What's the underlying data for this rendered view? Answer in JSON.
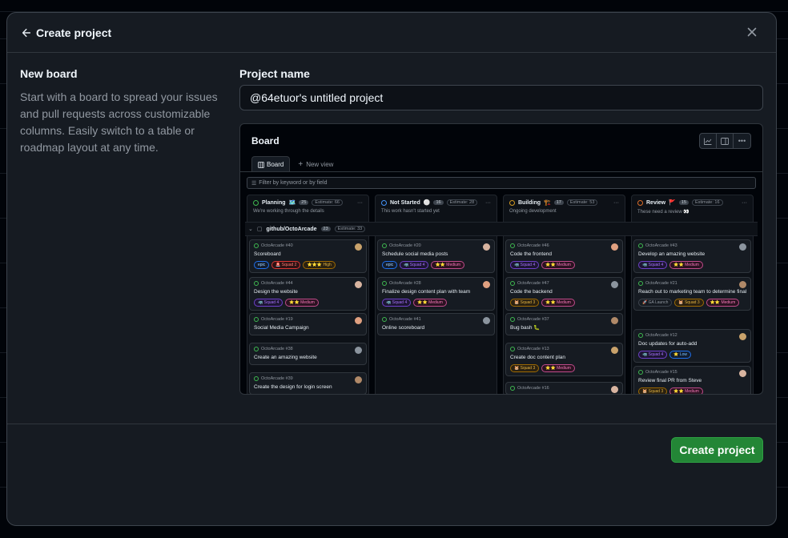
{
  "dialog": {
    "title": "Create project",
    "sidebar": {
      "title": "New board",
      "description": "Start with a board to spread your issues and pull requests across customizable columns. Easily switch to a table or roadmap layout at any time."
    },
    "field": {
      "label": "Project name",
      "value": "@64etuor's untitled project"
    },
    "submit_label": "Create project"
  },
  "preview": {
    "title": "Board",
    "tabs": {
      "active": "Board",
      "new": "New view"
    },
    "filter_placeholder": "Filter by keyword or by field",
    "group": {
      "name": "github/OctoArcade",
      "count": "23",
      "estimate": "Estimate: 33"
    },
    "columns": [
      {
        "name": "Planning",
        "emoji": "🗺️",
        "count": "25",
        "estimate": "Estimate: 66",
        "description": "We're working through the details",
        "status_color": "#3fb950",
        "cards": [
          {
            "ref": "OctoArcade #40",
            "title": "Scoreboard",
            "tags": [
              "epic",
              "🚨 Squad 2",
              "⭐⭐⭐ High"
            ]
          },
          {
            "ref": "OctoArcade #44",
            "title": "Design the website",
            "tags": [
              "🦏 Squad 4",
              "⭐⭐ Medium"
            ]
          },
          {
            "ref": "OctoArcade #19",
            "title": "Social Media Campaign",
            "tags": []
          },
          {
            "ref": "OctoArcade #38",
            "title": "Create an amazing website",
            "tags": []
          },
          {
            "ref": "OctoArcade #39",
            "title": "Create the design for login screen",
            "tags": []
          }
        ]
      },
      {
        "name": "Not Started",
        "emoji": "⚪",
        "count": "16",
        "estimate": "Estimate: 28",
        "description": "This work hasn't started yet",
        "status_color": "#4493f8",
        "cards": [
          {
            "ref": "OctoArcade #20",
            "title": "Schedule social media posts",
            "tags": [
              "epic",
              "🦏 Squad 4",
              "⭐⭐ Medium"
            ]
          },
          {
            "ref": "OctoArcade #28",
            "title": "Finalize design content plan with team",
            "tags": [
              "🦏 Squad 4",
              "⭐⭐ Medium"
            ]
          },
          {
            "ref": "OctoArcade #41",
            "title": "Online scoreboard",
            "tags": []
          }
        ]
      },
      {
        "name": "Building",
        "emoji": "🏗️",
        "count": "17",
        "estimate": "Estimate: 53",
        "description": "Ongoing development",
        "status_color": "#d29922",
        "cards": [
          {
            "ref": "OctoArcade #46",
            "title": "Code the frontend",
            "tags": [
              "🦏 Squad 4",
              "⭐⭐ Medium"
            ]
          },
          {
            "ref": "OctoArcade #47",
            "title": "Code the backend",
            "tags": [
              "🐹 Squad 3",
              "⭐⭐ Medium"
            ]
          },
          {
            "ref": "OctoArcade #37",
            "title": "Bug bash 🐛",
            "tags": []
          },
          {
            "ref": "OctoArcade #13",
            "title": "Create doc content plan",
            "tags": [
              "🐹 Squad 3",
              "⭐⭐ Medium"
            ]
          },
          {
            "ref": "OctoArcade #16",
            "title": "",
            "tags": []
          }
        ]
      },
      {
        "name": "Review",
        "emoji": "🚩",
        "count": "15",
        "estimate": "Estimate: 16",
        "description": "These need a review 👀",
        "status_color": "#db6d28",
        "cards": [
          {
            "ref": "OctoArcade #43",
            "title": "Develop an amazing website",
            "tags": [
              "🦏 Squad 4",
              "⭐⭐ Medium"
            ]
          },
          {
            "ref": "OctoArcade #21",
            "title": "Reach out to marketing team to determine final plan",
            "tags": [
              "🚀 GA Launch",
              "🐹 Squad 3",
              "⭐⭐ Medium"
            ]
          },
          {
            "ref": "OctoArcade #12",
            "title": "Doc updates for auto-add",
            "tags": [
              "🦏 Squad 4",
              "⭐ Low"
            ]
          },
          {
            "ref": "OctoArcade #15",
            "title": "Review final PR from Steve",
            "tags": [
              "🐹 Squad 3",
              "⭐⭐ Medium"
            ]
          }
        ]
      }
    ]
  },
  "icons": {
    "back": "arrow-left-icon",
    "close": "x-icon",
    "insights": "graph-icon",
    "layout": "sidebar-icon",
    "more": "kebab-horizontal-icon"
  }
}
